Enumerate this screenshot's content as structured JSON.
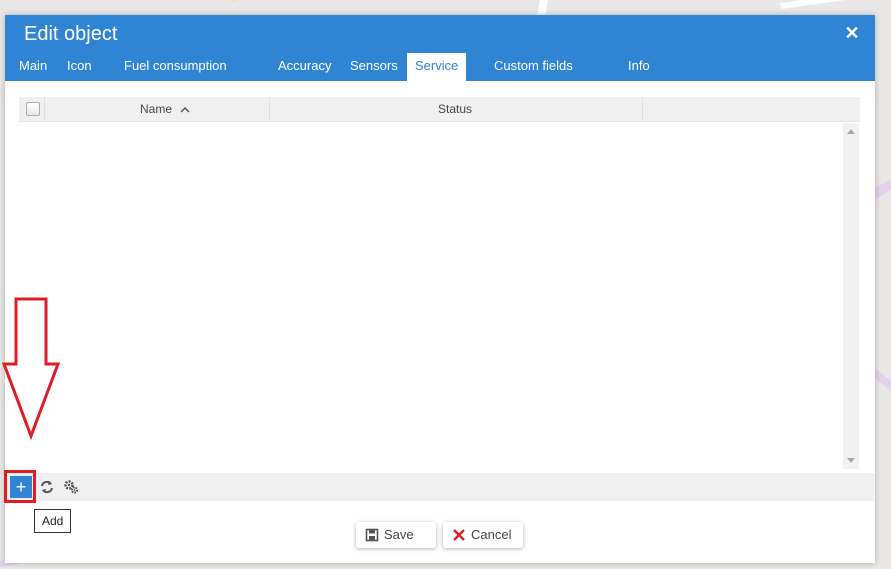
{
  "dialog": {
    "title": "Edit object",
    "close_glyph": "✕"
  },
  "tabs": [
    {
      "label": "Main"
    },
    {
      "label": "Icon"
    },
    {
      "label": "Fuel consumption"
    },
    {
      "label": "Accuracy"
    },
    {
      "label": "Sensors"
    },
    {
      "label": "Service"
    },
    {
      "label": "Custom fields"
    },
    {
      "label": "Info"
    }
  ],
  "active_tab": "Service",
  "grid": {
    "columns": [
      {
        "label": "Name",
        "sort": "ascending"
      },
      {
        "label": "Status"
      }
    ],
    "rows": []
  },
  "toolbar": {
    "add_glyph": "+",
    "add_tooltip": "Add",
    "icons": [
      "plus-icon",
      "refresh-icon",
      "settings-icon"
    ]
  },
  "footer": {
    "save_label": "Save",
    "cancel_label": "Cancel"
  },
  "colors": {
    "accent": "#2f84d3",
    "highlight": "#e01d26"
  }
}
